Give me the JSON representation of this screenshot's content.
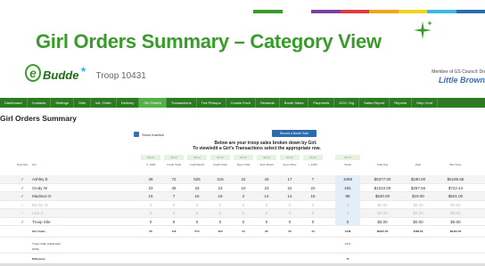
{
  "slide": {
    "title": "Girl Orders Summary – Category View",
    "stripe_colors": [
      "#3a9b2c",
      "#ffffff",
      "#7a3fa0",
      "#e03a3a",
      "#f2a51c",
      "#f2d21c",
      "#3ab8e8",
      "#2a6ab0"
    ]
  },
  "header": {
    "logo_letter": "e",
    "logo_word": "Budde",
    "logo_star": "★",
    "troop": "Troop 10431",
    "council": "Member of GS Council: Do",
    "brownie": "Little Brown"
  },
  "nav": {
    "items": [
      "Dashboard",
      "Contacts",
      "Settings",
      "Girls",
      "Init. Order",
      "Delivery",
      "Girl Orders",
      "Transactions",
      "Tmt Pickups",
      "Cookie Exch",
      "Rewards",
      "Booth Sales",
      "Payments",
      "GOC Org",
      "Sales Report",
      "Reports",
      "Help Cent"
    ],
    "active_index": 6
  },
  "page": {
    "title": "Girl Orders Summary",
    "show_inactive": "Show Inactive",
    "record_button": "Record a Booth Sale",
    "intro_line1": "Below are your troop sales broken down by Girl.",
    "intro_line2": "To view/edit a Girl's Transactions select the appropriate row."
  },
  "table": {
    "prices": [
      "$5.00",
      "$5.00",
      "$5.00",
      "$5.00",
      "$5.00",
      "$5.00",
      "$5.00",
      "$5.00",
      "$5.00"
    ],
    "headers": [
      "Goal Met",
      "Girl",
      "C_1000",
      "Credit Initial",
      "Credit Booth",
      "Credit Other",
      "Spec Initial",
      "Spec Booth",
      "Spec Other",
      "I_1000",
      "Totals",
      "Total Due",
      "Paid",
      "Bal. Dues"
    ],
    "rows": [
      {
        "check": "✓",
        "girl": "Ashley E",
        "vals": [
          "36",
          "72",
          "525",
          "315",
          "22",
          "43",
          "17",
          "7"
        ],
        "total": "1059",
        "due": "$5377.00",
        "paid": "$180.00",
        "bal": "$5186.56",
        "inactive": false
      },
      {
        "check": "✓",
        "girl": "Cindy W",
        "vals": [
          "23",
          "35",
          "33",
          "23",
          "10",
          "23",
          "22",
          "22"
        ],
        "total": "191",
        "due": "$1010.00",
        "paid": "$287.56",
        "bal": "$722.44",
        "inactive": false
      },
      {
        "check": "✓",
        "girl": "Madison D",
        "vals": [
          "15",
          "7",
          "16",
          "15",
          "2",
          "14",
          "14",
          "15"
        ],
        "total": "98",
        "due": "$520.00",
        "paid": "$19.00",
        "bal": "$501.00",
        "inactive": false
      },
      {
        "check": "✓",
        "girl": "Becky W",
        "vals": [
          "0",
          "0",
          "0",
          "0",
          "0",
          "0",
          "0",
          "0"
        ],
        "total": "0",
        "due": "$0.00",
        "paid": "$0.00",
        "bal": "$0.00",
        "inactive": true
      },
      {
        "check": "✓",
        "girl": "Lexi S",
        "vals": [
          "0",
          "0",
          "0",
          "0",
          "0",
          "0",
          "0",
          "0"
        ],
        "total": "0",
        "due": "$0.00",
        "paid": "$0.00",
        "bal": "$0.00",
        "inactive": true
      },
      {
        "check": "✓",
        "girl": "Troop Site",
        "vals": [
          "0",
          "0",
          "0",
          "0",
          "0",
          "0",
          "0",
          "0"
        ],
        "total": "0",
        "due": "$0.00",
        "paid": "$0.00",
        "bal": "$0.00",
        "inactive": false
      }
    ],
    "footer": {
      "girl_totals_label": "Girl Totals",
      "girl_totals": [
        "56",
        "116",
        "574",
        "353",
        "34",
        "80",
        "53",
        "44",
        "1348",
        "$6907.00",
        "$486.56",
        "$6410.00"
      ],
      "troop_order_label": "Troop Order (Initial April 2015)",
      "troop_order_total": "1471",
      "difference_label": "Difference",
      "difference_total": "71"
    }
  }
}
